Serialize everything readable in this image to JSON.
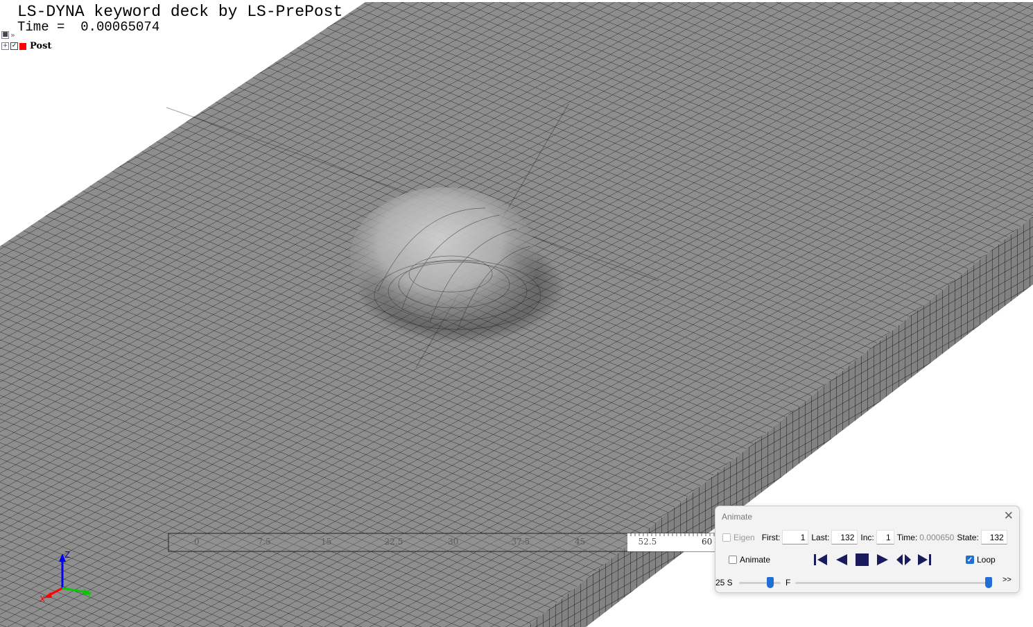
{
  "viewport": {
    "title_line1": "LS-DYNA keyword deck by LS-PrePost",
    "time_label": "Time =  0.00065074",
    "model_tree": {
      "part_label": "Post",
      "part_color": "#ff0000"
    },
    "ruler_ticks": [
      "0",
      "7.5",
      "15",
      "22.5",
      "30",
      "37.5",
      "45",
      "52.5",
      "60"
    ],
    "triad": {
      "x": "X",
      "y": "Y",
      "z": "Z",
      "x_color": "#ff0000",
      "y_color": "#00cc00",
      "z_color": "#0000ff"
    },
    "mesh_color": "#8c8c8c"
  },
  "animate": {
    "title": "Animate",
    "eigen_label": "Eigen",
    "first_label": "First:",
    "first_value": "1",
    "last_label": "Last:",
    "last_value": "132",
    "inc_label": "Inc:",
    "inc_value": "1",
    "time_label": "Time:",
    "time_value": "0.000650",
    "state_label": "State:",
    "state_value": "132",
    "animate_label": "Animate",
    "loop_label": "Loop",
    "loop_checked": true,
    "speed_label": "25 S",
    "frame_label": "F",
    "more_label": ">>",
    "accent_color": "#1f6fd6",
    "button_color": "#1a1a5e"
  }
}
